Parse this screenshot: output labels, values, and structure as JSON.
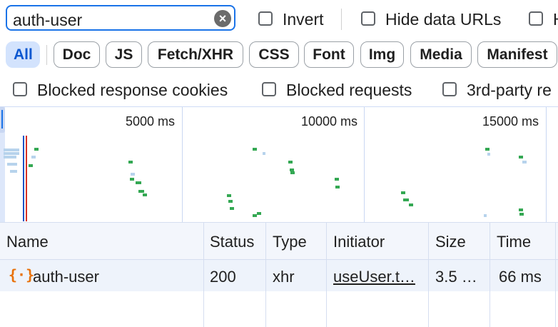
{
  "filter": {
    "search_value": "auth-user",
    "invert_label": "Invert",
    "hide_data_urls_label": "Hide data URLs",
    "next_checkbox_label": "H"
  },
  "chips": [
    {
      "label": "All",
      "active": true
    },
    {
      "label": "Doc"
    },
    {
      "label": "JS"
    },
    {
      "label": "Fetch/XHR"
    },
    {
      "label": "CSS"
    },
    {
      "label": "Font"
    },
    {
      "label": "Img"
    },
    {
      "label": "Media"
    },
    {
      "label": "Manifest"
    }
  ],
  "options": {
    "blocked_cookies_label": "Blocked response cookies",
    "blocked_requests_label": "Blocked requests",
    "third_party_label": "3rd-party re"
  },
  "overview": {
    "ticks": [
      "5000 ms",
      "10000 ms",
      "15000 ms"
    ],
    "colors": {
      "green": "#34a853",
      "light": "#b7d3ec",
      "blue_line": "#1a53c8",
      "red_line": "#d93025"
    }
  },
  "table": {
    "columns": [
      "Name",
      "Status",
      "Type",
      "Initiator",
      "Size",
      "Time"
    ],
    "rows": [
      {
        "name": "auth-user",
        "status": "200",
        "type": "xhr",
        "initiator": "useUser.t…",
        "size": "3.5 …",
        "time": "66 ms"
      }
    ]
  }
}
